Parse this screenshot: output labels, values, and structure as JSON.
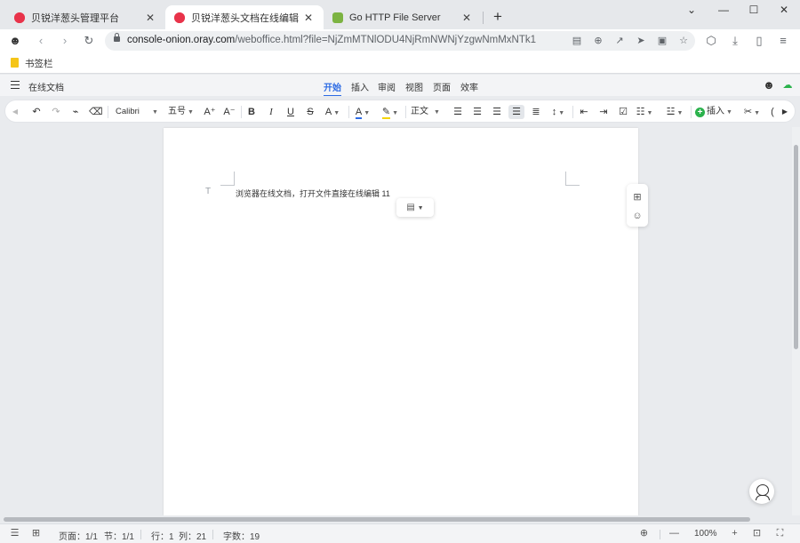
{
  "browser": {
    "tabs": [
      {
        "title": "贝锐洋葱头管理平台",
        "icon": "oray-onion-icon"
      },
      {
        "title": "贝锐洋葱头文档在线编辑",
        "icon": "oray-onion-icon",
        "active": true
      },
      {
        "title": "Go HTTP File Server",
        "icon": "gohttp-icon"
      }
    ],
    "new_tab_label": "+",
    "url_domain": "console-onion.oray.com",
    "url_path": "/weboffice.html?file=NjZmMTNlODU4NjRmNWNjYzgwNmMxNTk1",
    "bookmarks": {
      "folder_label": "书签栏"
    }
  },
  "app": {
    "name": "在线文档",
    "menu_tabs": [
      "开始",
      "插入",
      "审阅",
      "视图",
      "页面",
      "效率"
    ],
    "active_tab": "开始",
    "accent_color": "#2d6be4"
  },
  "toolbar": {
    "font_name": "Calibri",
    "font_size": "五号",
    "style_label": "正文",
    "insert_label": "插入",
    "grow_font": "A⁺",
    "shrink_font": "A⁻",
    "bold": "B",
    "italic": "I",
    "underline": "U",
    "strike": "S"
  },
  "document": {
    "paragraph_mark": "T",
    "text": "浏览器在线文档，打开文件直接在线编辑 11"
  },
  "status": {
    "page": "页面：1/1",
    "section": "节：1/1",
    "row": "行：1",
    "col": "列：21",
    "word_count": "字数：19",
    "zoom": "100%"
  }
}
